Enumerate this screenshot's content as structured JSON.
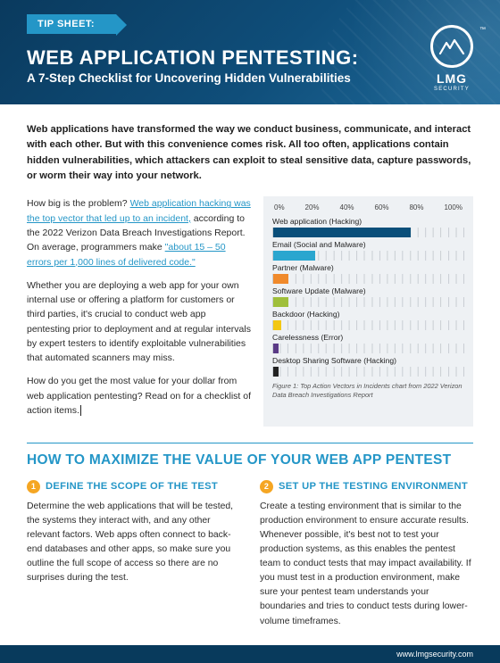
{
  "hero": {
    "ribbon": "TIP SHEET:",
    "title": "WEB APPLICATION PENTESTING:",
    "subtitle": "A 7-Step Checklist for Uncovering Hidden Vulnerabilities",
    "logo_text": "LMG",
    "logo_sub": "SECURITY",
    "logo_tm": "™"
  },
  "intro": "Web applications have transformed the way we conduct business, communicate, and interact with each other. But with this convenience comes risk. All too often, applications contain hidden vulnerabilities, which attackers can exploit to steal sensitive data, capture passwords, or worm their way into your network.",
  "body": {
    "p1_a": "How big is the problem? ",
    "p1_link": "Web application hacking was the top vector that led up to an incident,",
    "p1_b": " according to the 2022 Verizon Data Breach Investigations Report. On average, programmers make ",
    "p1_link2": "\"about 15 – 50 errors per 1,000 lines of delivered code.\"",
    "p2": "Whether you are deploying a web app for your own internal use or offering a platform for customers or third parties, it's crucial to conduct web app pentesting prior to deployment and at regular intervals by expert testers to identify exploitable vulnerabilities that automated scanners may miss.",
    "p3": "How do you get the most value for your dollar from web application pentesting? Read on for a checklist of action items."
  },
  "chart_data": {
    "type": "bar",
    "orientation": "horizontal",
    "title": "",
    "xlabel": "",
    "ylabel": "",
    "xlim": [
      0,
      100
    ],
    "ticks": [
      "0%",
      "20%",
      "40%",
      "60%",
      "80%",
      "100%"
    ],
    "series": [
      {
        "name": "Web application (Hacking)",
        "value": 72,
        "color": "#0a4f7a"
      },
      {
        "name": "Email (Social and Malware)",
        "value": 22,
        "color": "#2aa6cf"
      },
      {
        "name": "Partner (Malware)",
        "value": 8,
        "color": "#f08a2c"
      },
      {
        "name": "Software Update (Malware)",
        "value": 8,
        "color": "#9fbf3b"
      },
      {
        "name": "Backdoor (Hacking)",
        "value": 4,
        "color": "#f3c712"
      },
      {
        "name": "Carelessness (Error)",
        "value": 3,
        "color": "#5a3a86"
      },
      {
        "name": "Desktop Sharing Software (Hacking)",
        "value": 3,
        "color": "#222222"
      }
    ],
    "caption": "Figure 1: Top Action Vectors in Incidents chart from 2022 Verizon Data Breach Investigations Report"
  },
  "section": {
    "title": "HOW TO MAXIMIZE THE VALUE OF YOUR WEB APP PENTEST",
    "steps": [
      {
        "num": "1",
        "title": "DEFINE THE SCOPE OF THE TEST",
        "body": "Determine the web applications that will be tested, the systems they interact with, and any other relevant factors. Web apps often connect to back-end databases and other apps, so make sure you outline the full scope of access so there are no surprises during the test."
      },
      {
        "num": "2",
        "title": "SET UP THE TESTING ENVIRONMENT",
        "body": "Create a testing environment that is similar to the production environment to ensure accurate results. Whenever possible, it's best not to test your production systems, as this enables the pentest team to conduct tests that may impact availability. If you must test in a production environment, make sure your pentest team understands your boundaries and tries to conduct tests during lower-volume timeframes."
      }
    ]
  },
  "footer": {
    "url": "www.lmgsecurity.com"
  }
}
